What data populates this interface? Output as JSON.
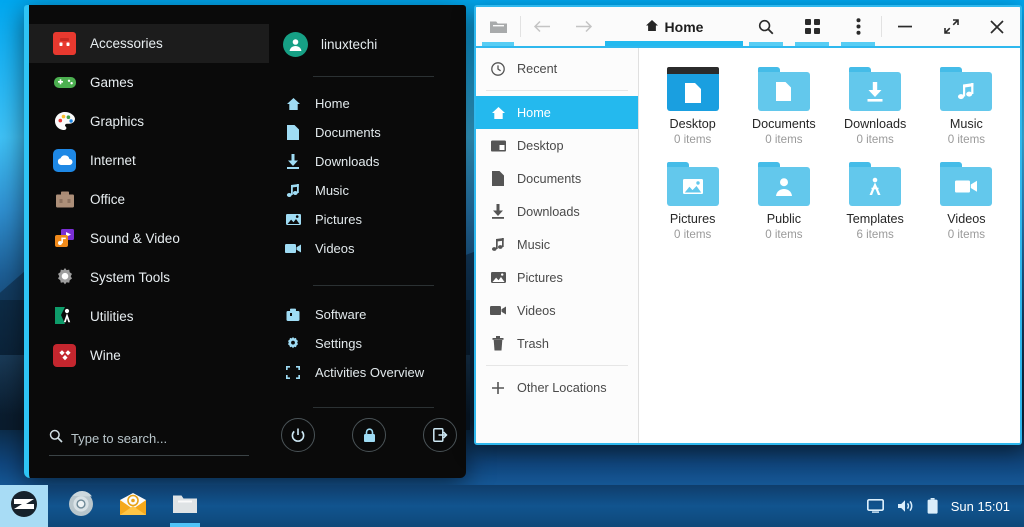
{
  "desktop": {
    "wallpaper_description": "blue sky gradient with dark mountain silhouette"
  },
  "start_menu": {
    "categories": [
      {
        "label": "Accessories",
        "icon": "toolbox-icon",
        "active": true
      },
      {
        "label": "Games",
        "icon": "gamepad-icon",
        "active": false
      },
      {
        "label": "Graphics",
        "icon": "palette-icon",
        "active": false
      },
      {
        "label": "Internet",
        "icon": "cloud-icon",
        "active": false
      },
      {
        "label": "Office",
        "icon": "briefcase-icon",
        "active": false
      },
      {
        "label": "Sound & Video",
        "icon": "music-video-icon",
        "active": false
      },
      {
        "label": "System Tools",
        "icon": "gear-icon",
        "active": false
      },
      {
        "label": "Utilities",
        "icon": "compass-icon",
        "active": false
      },
      {
        "label": "Wine",
        "icon": "wine-diamond-icon",
        "active": false
      }
    ],
    "search": {
      "placeholder": "Type to search...",
      "value": "",
      "icon": "search-icon"
    },
    "user": {
      "name": "linuxtechi",
      "avatar_icon": "user-avatar-icon"
    },
    "places": [
      {
        "label": "Home",
        "icon": "home-icon"
      },
      {
        "label": "Documents",
        "icon": "document-icon"
      },
      {
        "label": "Downloads",
        "icon": "download-icon"
      },
      {
        "label": "Music",
        "icon": "music-note-icon"
      },
      {
        "label": "Pictures",
        "icon": "image-icon"
      },
      {
        "label": "Videos",
        "icon": "video-camera-icon"
      }
    ],
    "system": [
      {
        "label": "Software",
        "icon": "software-bag-icon"
      },
      {
        "label": "Settings",
        "icon": "gear-icon"
      },
      {
        "label": "Activities Overview",
        "icon": "overview-brackets-icon"
      }
    ],
    "power_buttons": [
      {
        "name": "shutdown",
        "icon": "power-icon"
      },
      {
        "name": "lock",
        "icon": "lock-icon"
      },
      {
        "name": "logout",
        "icon": "logout-icon"
      }
    ]
  },
  "file_manager": {
    "header": {
      "path_icon": "folder-open-icon",
      "back_icon": "arrow-left-icon",
      "forward_icon": "arrow-right-icon",
      "title": "Home",
      "title_icon": "home-icon",
      "search_icon": "search-icon",
      "view_grid_icon": "grid-view-icon",
      "menu_icon": "three-dots-menu-icon",
      "minimize_icon": "minimize-icon",
      "maximize_icon": "maximize-icon",
      "close_icon": "close-icon"
    },
    "sidebar": [
      {
        "label": "Recent",
        "icon": "clock-icon",
        "active": false
      },
      {
        "label": "Home",
        "icon": "home-icon",
        "active": true
      },
      {
        "label": "Desktop",
        "icon": "desktop-icon",
        "active": false
      },
      {
        "label": "Documents",
        "icon": "document-icon",
        "active": false
      },
      {
        "label": "Downloads",
        "icon": "download-icon",
        "active": false
      },
      {
        "label": "Music",
        "icon": "music-note-icon",
        "active": false
      },
      {
        "label": "Pictures",
        "icon": "image-icon",
        "active": false
      },
      {
        "label": "Videos",
        "icon": "video-camera-icon",
        "active": false
      },
      {
        "label": "Trash",
        "icon": "trash-icon",
        "active": false
      },
      {
        "label": "Other Locations",
        "icon": "plus-icon",
        "active": false
      }
    ],
    "files": [
      {
        "name": "Desktop",
        "items": "0 items",
        "icon": "desktop-folder-icon"
      },
      {
        "name": "Documents",
        "items": "0 items",
        "icon": "documents-folder-icon"
      },
      {
        "name": "Downloads",
        "items": "0 items",
        "icon": "downloads-folder-icon"
      },
      {
        "name": "Music",
        "items": "0 items",
        "icon": "music-folder-icon"
      },
      {
        "name": "Pictures",
        "items": "0 items",
        "icon": "pictures-folder-icon"
      },
      {
        "name": "Public",
        "items": "0 items",
        "icon": "public-folder-icon"
      },
      {
        "name": "Templates",
        "items": "6 items",
        "icon": "templates-folder-icon"
      },
      {
        "name": "Videos",
        "items": "0 items",
        "icon": "videos-folder-icon"
      }
    ]
  },
  "taskbar": {
    "start_button": {
      "name": "zorin-menu-button",
      "icon": "zorin-logo-icon"
    },
    "apps": [
      {
        "name": "chromium",
        "icon": "chromium-icon",
        "running": false
      },
      {
        "name": "mail",
        "icon": "mail-icon",
        "running": false
      },
      {
        "name": "files",
        "icon": "file-manager-icon",
        "running": true
      }
    ],
    "tray": [
      {
        "name": "display",
        "icon": "display-icon"
      },
      {
        "name": "volume",
        "icon": "volume-icon"
      },
      {
        "name": "battery",
        "icon": "battery-icon"
      }
    ],
    "clock": "Sun 15:01"
  },
  "colors": {
    "accent": "#24b9ee",
    "menu_bg": "#0a0a0a",
    "folder_blue": "#63c8ec",
    "taskbar_blue": "#11548f"
  }
}
